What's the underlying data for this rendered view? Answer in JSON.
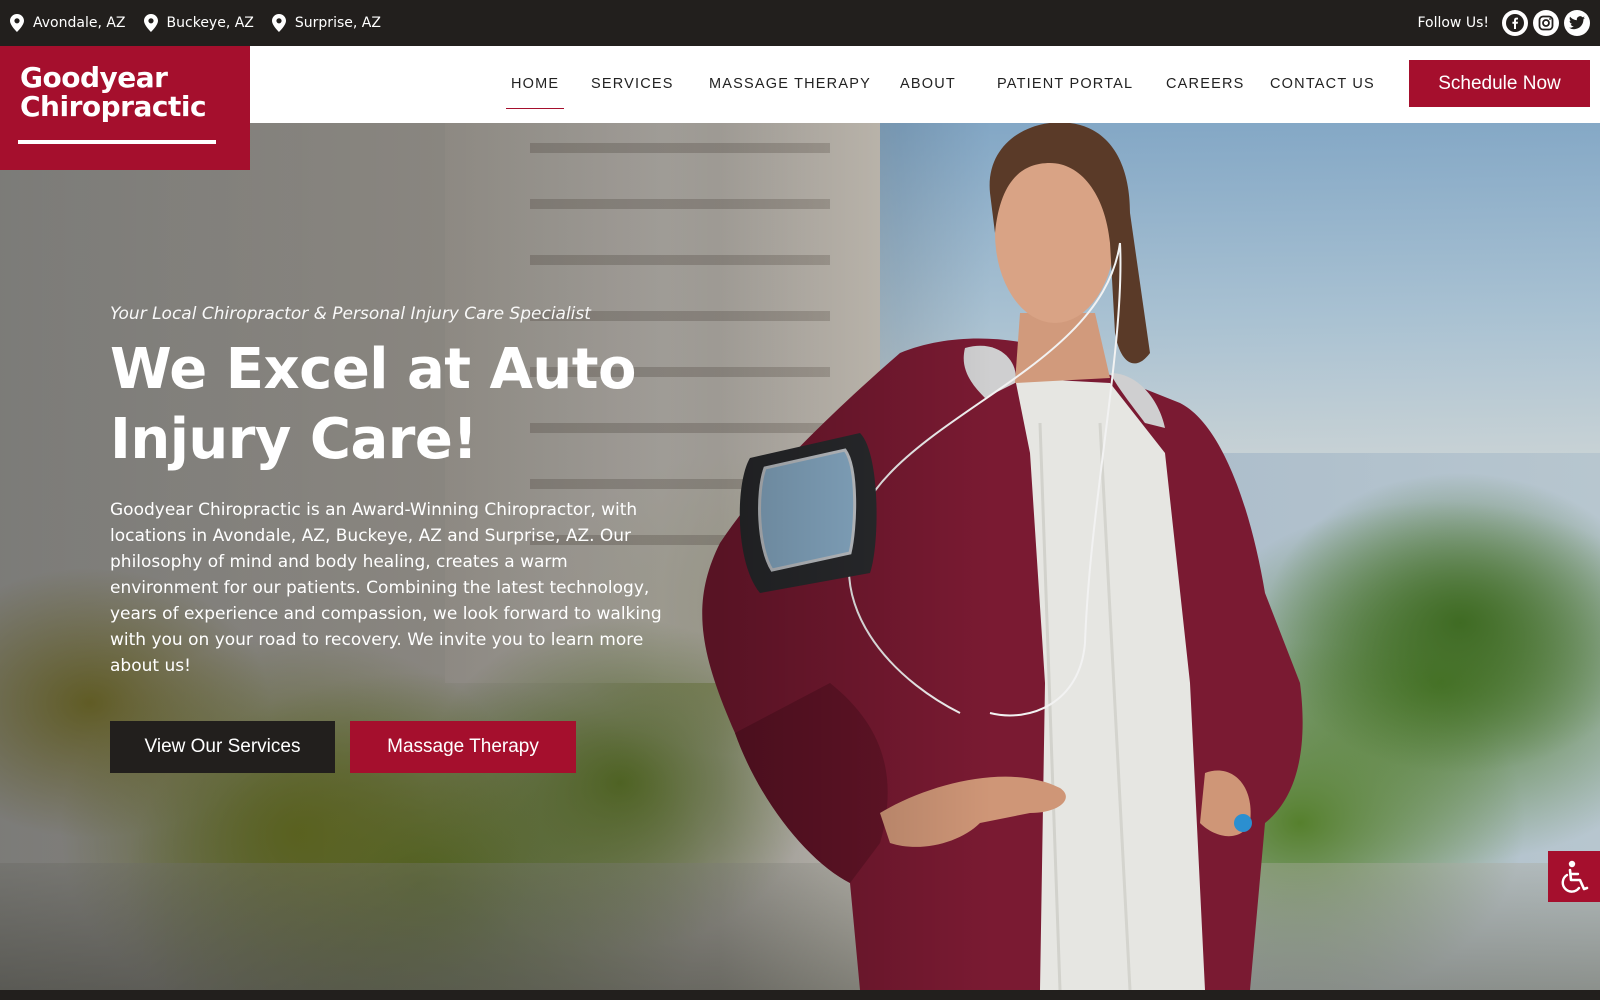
{
  "topbar": {
    "locations": [
      "Avondale, AZ",
      "Buckeye, AZ",
      "Surprise, AZ"
    ],
    "follow_label": "Follow Us!",
    "social_icons": [
      "facebook-icon",
      "instagram-icon",
      "twitter-icon"
    ]
  },
  "logo": {
    "line1": "Goodyear",
    "line2": "Chiropractic"
  },
  "nav": {
    "items": [
      "HOME",
      "SERVICES",
      "MASSAGE THERAPY",
      "ABOUT",
      "PATIENT PORTAL",
      "CAREERS",
      "CONTACT US"
    ],
    "active": "HOME",
    "cta": "Schedule Now"
  },
  "hero": {
    "tagline": "Your Local Chiropractor & Personal Injury Care Specialist",
    "headline": "We Excel at Auto Injury Care!",
    "intro": "Goodyear Chiropractic is an Award-Winning Chiropractor, with locations in Avondale, AZ, Buckeye, AZ and Surprise, AZ. Our philosophy of mind and body healing, creates a warm environment for our patients. Combining the latest technology, years of experience and compassion, we look forward to walking with you on your road to recovery. We invite you to learn more about us!",
    "buttons": [
      "View Our Services",
      "Massage Therapy"
    ]
  },
  "colors": {
    "brand": "#a50f2d",
    "dark": "#221f1d",
    "white": "#ffffff"
  },
  "accessibility_icon": "wheelchair-icon"
}
